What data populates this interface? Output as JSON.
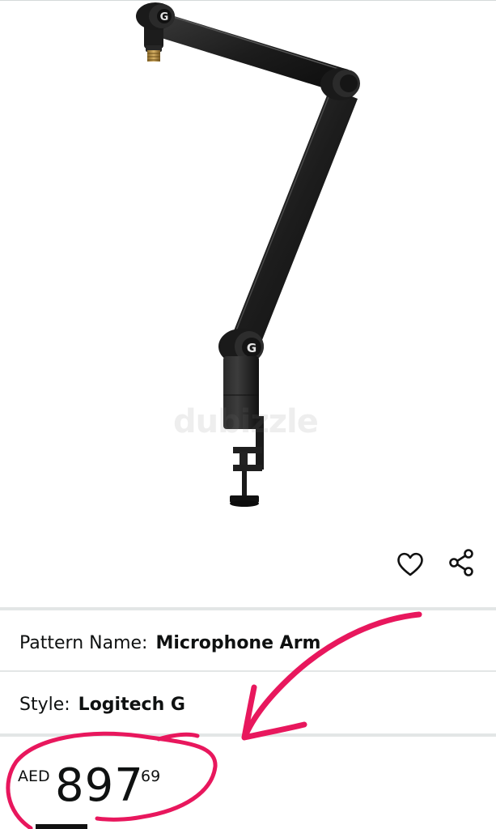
{
  "product": {
    "image_alt": "Logitech G boom arm",
    "watermark": "dubizzle"
  },
  "actions": {
    "favorite_icon": "heart-icon",
    "share_icon": "share-icon"
  },
  "variations": [
    {
      "label": "Pattern Name:",
      "value": "Microphone Arm"
    },
    {
      "label": "Style:",
      "value": "Logitech G"
    }
  ],
  "price": {
    "currency": "AED",
    "whole": "897",
    "fraction": "69"
  },
  "colors": {
    "annotation": "#e8175d",
    "text": "#0f1111",
    "divider": "#e3e6e6"
  }
}
